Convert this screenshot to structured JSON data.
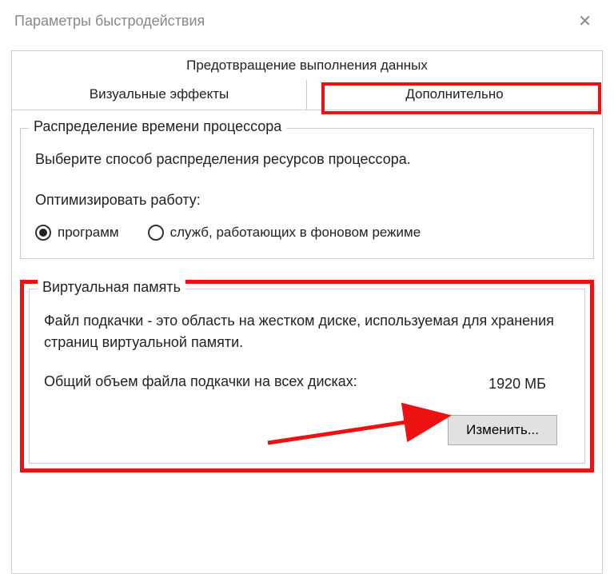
{
  "window": {
    "title": "Параметры быстродействия"
  },
  "tabs": {
    "top": "Предотвращение выполнения данных",
    "left": "Визуальные эффекты",
    "right": "Дополнительно"
  },
  "cpu_group": {
    "legend": "Распределение времени процессора",
    "description": "Выберите способ распределения ресурсов процессора.",
    "optimize_label": "Оптимизировать работу:",
    "radio_programs": "программ",
    "radio_services": "служб, работающих в фоновом режиме"
  },
  "vm_group": {
    "legend": "Виртуальная память",
    "description": "Файл подкачки - это область на жестком диске, используемая для хранения страниц виртуальной памяти.",
    "size_label": "Общий объем файла подкачки на всех дисках:",
    "size_value": "1920 МБ",
    "change_button": "Изменить..."
  }
}
